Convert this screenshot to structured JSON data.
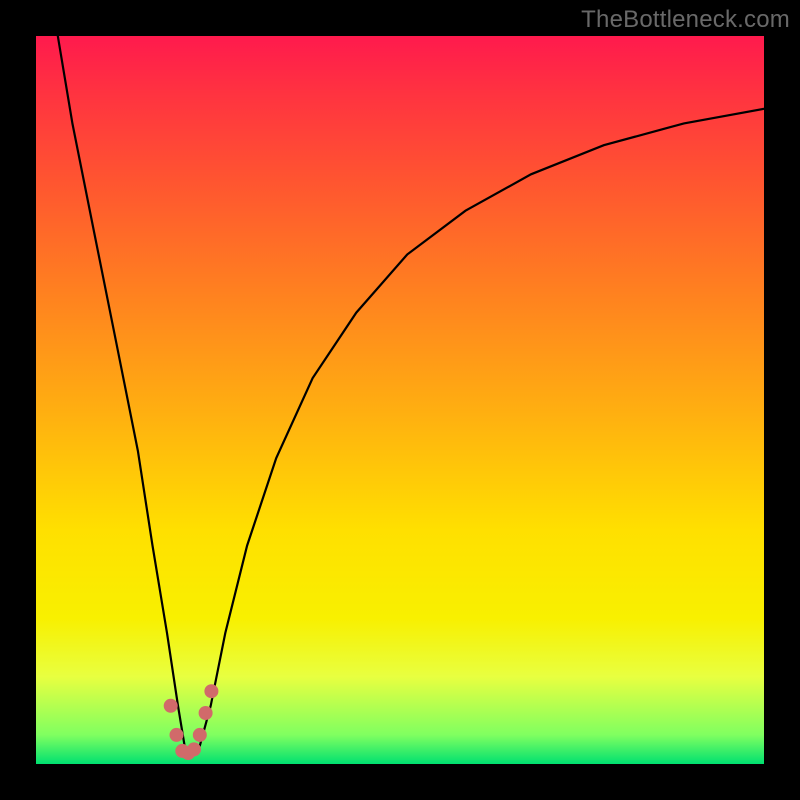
{
  "watermark": "TheBottleneck.com",
  "chart_data": {
    "type": "line",
    "title": "",
    "xlabel": "",
    "ylabel": "",
    "xlim": [
      0,
      100
    ],
    "ylim": [
      0,
      100
    ],
    "grid": false,
    "series": [
      {
        "name": "bottleneck-curve",
        "x": [
          3,
          5,
          8,
          11,
          14,
          16,
          18,
          19.5,
          20.5,
          21.5,
          22.5,
          24,
          26,
          29,
          33,
          38,
          44,
          51,
          59,
          68,
          78,
          89,
          100
        ],
        "values": [
          100,
          88,
          73,
          58,
          43,
          30,
          18,
          8,
          2,
          1.5,
          2.5,
          8,
          18,
          30,
          42,
          53,
          62,
          70,
          76,
          81,
          85,
          88,
          90
        ]
      }
    ],
    "markers": {
      "name": "highlight-points",
      "color": "#d16a6a",
      "x": [
        18.5,
        19.3,
        20.1,
        20.9,
        21.7,
        22.5,
        23.3,
        24.1
      ],
      "values": [
        8,
        4,
        1.8,
        1.5,
        2,
        4,
        7,
        10
      ]
    },
    "gradient_stops": [
      {
        "pos": 0.0,
        "color": "#ff1a4d"
      },
      {
        "pos": 0.2,
        "color": "#ff5530"
      },
      {
        "pos": 0.5,
        "color": "#ffb010"
      },
      {
        "pos": 0.8,
        "color": "#f8f000"
      },
      {
        "pos": 0.96,
        "color": "#80ff60"
      },
      {
        "pos": 1.0,
        "color": "#00e070"
      }
    ]
  }
}
